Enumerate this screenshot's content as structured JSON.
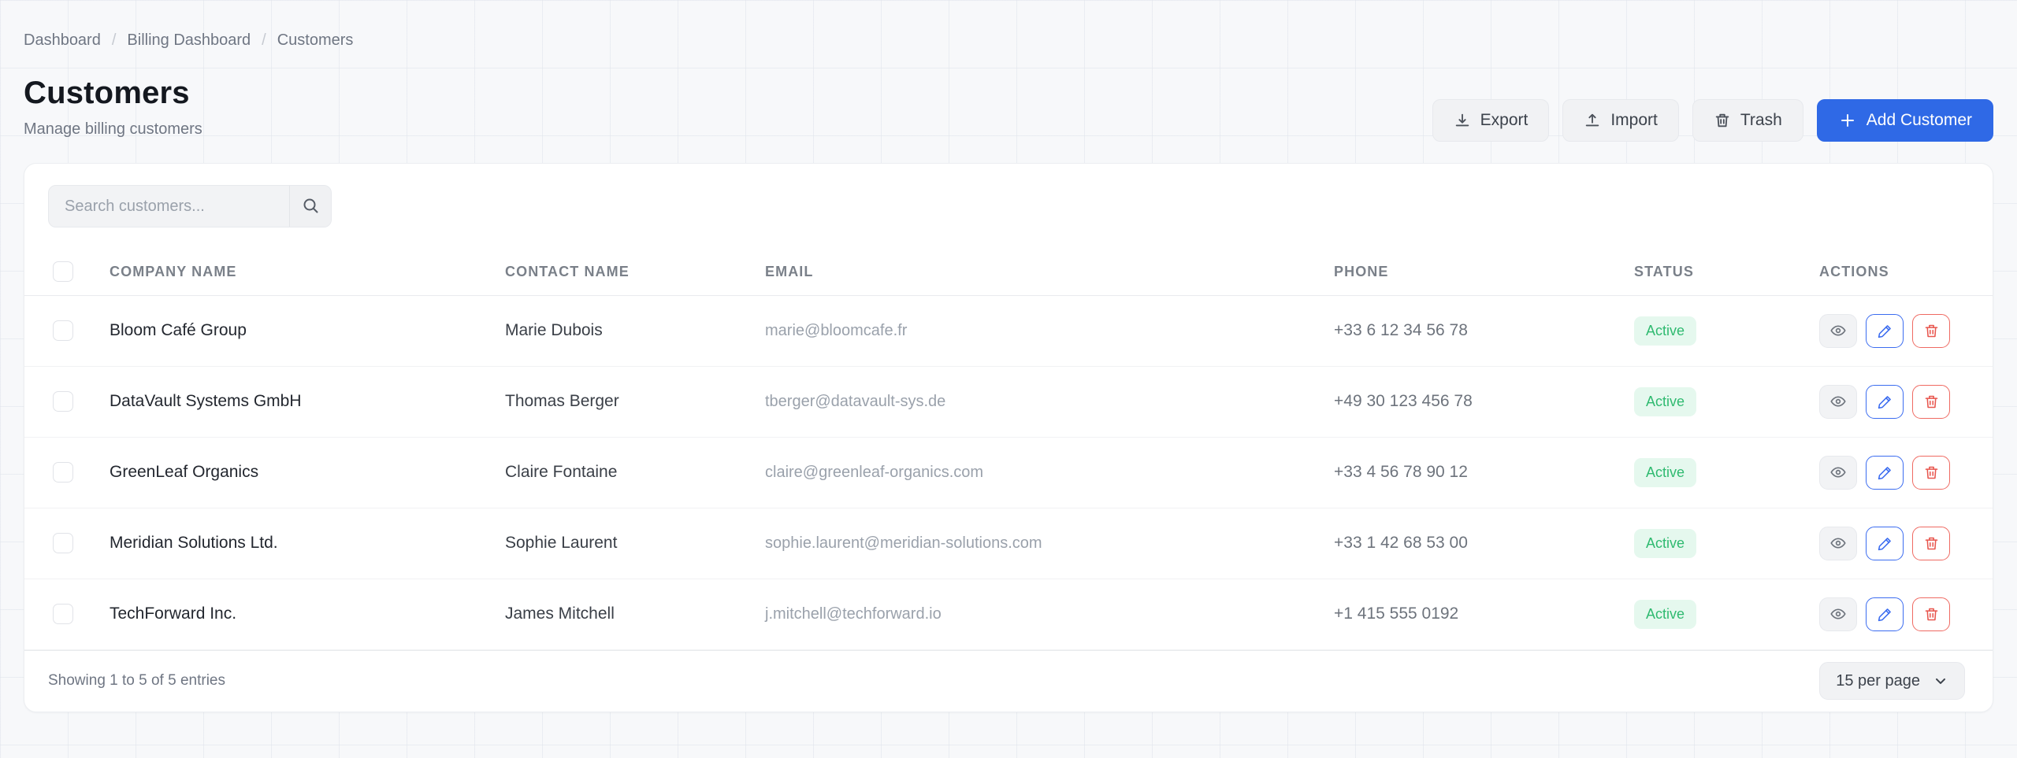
{
  "breadcrumb": {
    "separator": "/",
    "items": [
      "Dashboard",
      "Billing Dashboard",
      "Customers"
    ]
  },
  "header": {
    "title": "Customers",
    "subtitle": "Manage billing customers",
    "export_label": "Export",
    "import_label": "Import",
    "trash_label": "Trash",
    "add_label": "Add Customer"
  },
  "search": {
    "placeholder": "Search customers..."
  },
  "table": {
    "columns": {
      "company": "COMPANY NAME",
      "contact": "CONTACT NAME",
      "email": "EMAIL",
      "phone": "PHONE",
      "status": "STATUS",
      "actions": "ACTIONS"
    },
    "rows": [
      {
        "company": "Bloom Café Group",
        "contact": "Marie Dubois",
        "email": "marie@bloomcafe.fr",
        "phone": "+33 6 12 34 56 78",
        "status": "Active"
      },
      {
        "company": "DataVault Systems GmbH",
        "contact": "Thomas Berger",
        "email": "tberger@datavault-sys.de",
        "phone": "+49 30 123 456 78",
        "status": "Active"
      },
      {
        "company": "GreenLeaf Organics",
        "contact": "Claire Fontaine",
        "email": "claire@greenleaf-organics.com",
        "phone": "+33 4 56 78 90 12",
        "status": "Active"
      },
      {
        "company": "Meridian Solutions Ltd.",
        "contact": "Sophie Laurent",
        "email": "sophie.laurent@meridian-solutions.com",
        "phone": "+33 1 42 68 53 00",
        "status": "Active"
      },
      {
        "company": "TechForward Inc.",
        "contact": "James Mitchell",
        "email": "j.mitchell@techforward.io",
        "phone": "+1 415 555 0192",
        "status": "Active"
      }
    ]
  },
  "footer": {
    "summary": "Showing 1 to 5 of 5 entries",
    "per_page": "15 per page"
  },
  "icons": {
    "export": "download-icon",
    "import": "upload-icon",
    "trash": "trash-icon",
    "add": "plus-icon",
    "search": "search-icon",
    "view": "eye-icon",
    "edit": "pencil-icon",
    "delete": "trash-icon",
    "per_page": "chevron-down-icon"
  },
  "colors": {
    "accent_blue": "#2f69e6",
    "status_green": "#2fba70",
    "status_green_bg": "#e5f8ee",
    "danger_red": "#e8564e",
    "page_bg": "#f7f8fa"
  }
}
